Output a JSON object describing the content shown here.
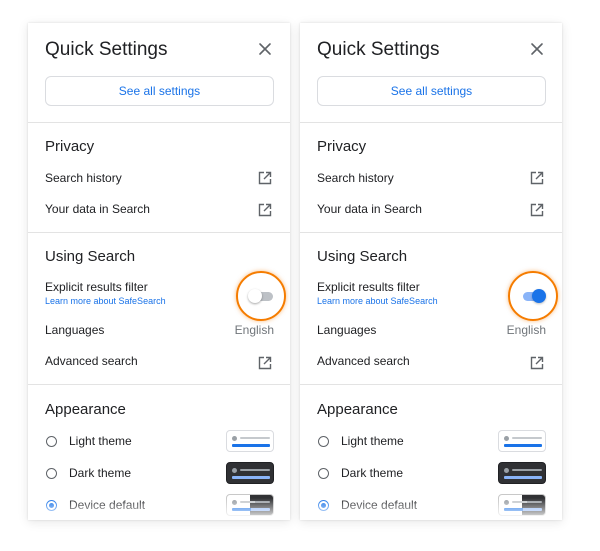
{
  "panels": [
    {
      "title": "Quick Settings",
      "see_all_label": "See all settings",
      "privacy": {
        "heading": "Privacy",
        "search_history_label": "Search history",
        "your_data_label": "Your data in Search"
      },
      "using_search": {
        "heading": "Using Search",
        "explicit_filter_label": "Explicit results filter",
        "safesearch_link": "Learn more about SafeSearch",
        "explicit_filter_on": false,
        "languages_label": "Languages",
        "languages_value": "English",
        "advanced_search_label": "Advanced search"
      },
      "appearance": {
        "heading": "Appearance",
        "themes": [
          {
            "label": "Light theme",
            "selected": false
          },
          {
            "label": "Dark theme",
            "selected": false
          },
          {
            "label": "Device default",
            "selected": true
          }
        ]
      }
    },
    {
      "title": "Quick Settings",
      "see_all_label": "See all settings",
      "privacy": {
        "heading": "Privacy",
        "search_history_label": "Search history",
        "your_data_label": "Your data in Search"
      },
      "using_search": {
        "heading": "Using Search",
        "explicit_filter_label": "Explicit results filter",
        "safesearch_link": "Learn more about SafeSearch",
        "explicit_filter_on": true,
        "languages_label": "Languages",
        "languages_value": "English",
        "advanced_search_label": "Advanced search"
      },
      "appearance": {
        "heading": "Appearance",
        "themes": [
          {
            "label": "Light theme",
            "selected": false
          },
          {
            "label": "Dark theme",
            "selected": false
          },
          {
            "label": "Device default",
            "selected": true
          }
        ]
      }
    }
  ],
  "colors": {
    "accent": "#1a73e8",
    "highlight_ring": "#f57c00",
    "text": "#202124",
    "secondary_text": "#70757a"
  },
  "icons": {
    "close": "close-icon",
    "external": "open-in-new-icon"
  }
}
